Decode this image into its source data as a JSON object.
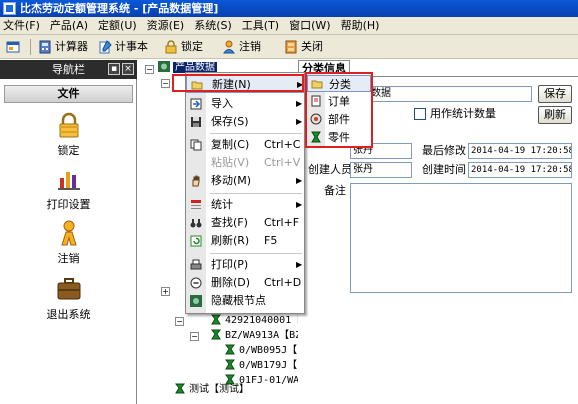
{
  "window": {
    "title": "比杰劳动定额管理系统 - [产品数据管理]"
  },
  "menu": [
    "文件(F)",
    "产品(A)",
    "定额(U)",
    "资源(E)",
    "系统(S)",
    "工具(T)",
    "窗口(W)",
    "帮助(H)"
  ],
  "toolbar": {
    "calc": "计算器",
    "notes": "计事本",
    "lock": "锁定",
    "logout": "注销",
    "close": "关闭"
  },
  "nav": {
    "title": "导航栏",
    "section": "文件",
    "items": [
      "锁定",
      "打印设置",
      "注销",
      "退出系统"
    ]
  },
  "tree": {
    "root": "产品数据",
    "rows": [
      "42921040001【",
      "BZ/WA913A【BZ",
      "0/WB095J【",
      "0/WB179J【",
      "01FJ-01/WA",
      "测试【测试】"
    ]
  },
  "panel": {
    "tab": "分类信息",
    "name_value": "数据",
    "stat_check_label": "用作统计数量",
    "save": "保存",
    "refresh": "刷新",
    "creator_label": "创建人员",
    "creator_value": "张丹",
    "modifier_value": "张丹",
    "last_modified_label": "最后修改",
    "last_modified_value": "2014-04-19 17:20:58",
    "created_label": "创建时间",
    "created_value": "2014-04-19 17:20:58",
    "remark_label": "备注"
  },
  "context_menu": [
    {
      "label": "新建(N)",
      "shortcut": "",
      "arrow": "▶"
    },
    {
      "label": "导入",
      "shortcut": "",
      "arrow": "▶"
    },
    {
      "label": "保存(S)",
      "shortcut": "",
      "arrow": "▶"
    },
    {
      "label": "复制(C)",
      "shortcut": "Ctrl+C",
      "arrow": ""
    },
    {
      "label": "粘贴(V)",
      "shortcut": "Ctrl+V",
      "arrow": ""
    },
    {
      "label": "移动(M)",
      "shortcut": "",
      "arrow": "▶"
    },
    {
      "label": "统计",
      "shortcut": "",
      "arrow": "▶"
    },
    {
      "label": "查找(F)",
      "shortcut": "Ctrl+F",
      "arrow": ""
    },
    {
      "label": "刷新(R)",
      "shortcut": "F5",
      "arrow": ""
    },
    {
      "label": "打印(P)",
      "shortcut": "",
      "arrow": "▶"
    },
    {
      "label": "删除(D)",
      "shortcut": "Ctrl+D",
      "arrow": ""
    },
    {
      "label": "隐藏根节点",
      "shortcut": "",
      "arrow": ""
    }
  ],
  "submenu": [
    "分类",
    "订单",
    "部件",
    "零件"
  ],
  "colors": {
    "title_bar": "#0a58d8",
    "highlight_border": "#e02020",
    "nav_header": "#2c2c2c",
    "menu_bg": "#ece9d8"
  }
}
